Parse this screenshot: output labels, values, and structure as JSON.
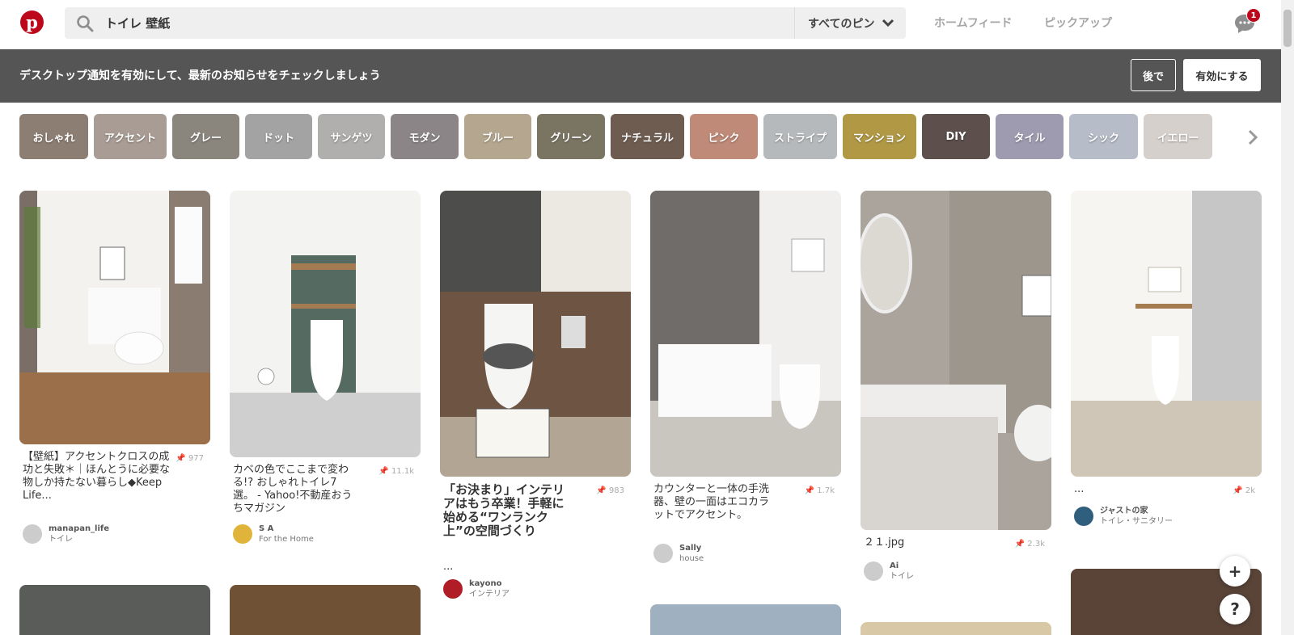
{
  "search": {
    "query": "トイレ 壁紙",
    "scope": "すべてのピン"
  },
  "nav": {
    "home_feed": "ホームフィード",
    "picks": "ピックアップ",
    "messages_badge": "1"
  },
  "notification": {
    "text": "デスクトップ通知を有効にして、最新のお知らせをチェックしましょう",
    "later": "後で",
    "enable": "有効にする"
  },
  "categories": [
    {
      "label": "おしゃれ",
      "color": "#8d7e73"
    },
    {
      "label": "アクセント",
      "color": "#a89c94"
    },
    {
      "label": "グレー",
      "color": "#8a857d"
    },
    {
      "label": "ドット",
      "color": "#a3a3a3"
    },
    {
      "label": "サンゲツ",
      "color": "#b0afad"
    },
    {
      "label": "モダン",
      "color": "#8b8587"
    },
    {
      "label": "ブルー",
      "color": "#b5a78f"
    },
    {
      "label": "グリーン",
      "color": "#7a7563"
    },
    {
      "label": "ナチュラル",
      "color": "#6e5c50"
    },
    {
      "label": "ピンク",
      "color": "#bf8a78"
    },
    {
      "label": "ストライプ",
      "color": "#b6b9bb"
    },
    {
      "label": "マンション",
      "color": "#b09845"
    },
    {
      "label": "DIY",
      "color": "#5c4f4c"
    },
    {
      "label": "タイル",
      "color": "#9e9bb0"
    },
    {
      "label": "シック",
      "color": "#b6bcc8"
    },
    {
      "label": "イエロー",
      "color": "#d6d0cd"
    }
  ],
  "pins": [
    {
      "title": "【壁紙】アクセントクロスの成功と失敗＊｜ほんとうに必要な物しか持たない暮らし◆Keep Life...",
      "saves": "977",
      "user": "manapan_life",
      "board": "トイレ"
    },
    {
      "title": "カベの色でここまで変わる!? おしゃれトイレ7選。 - Yahoo!不動産おうちマガジン",
      "saves": "11.1k",
      "user": "S A",
      "board": "For the Home"
    },
    {
      "title": "「お決まり」インテリアはもう卒業！手軽に始める“ワンランク上”の空間づくり",
      "extra": "...",
      "saves": "983",
      "user": "kayono",
      "board": "インテリア"
    },
    {
      "title": "カウンターと一体の手洗器、壁の一面はエコカラットでアクセント。",
      "saves": "1.7k",
      "user": "Sally",
      "board": "house"
    },
    {
      "title": "２１.jpg",
      "saves": "2.3k",
      "user": "Ai",
      "board": "トイレ"
    },
    {
      "title": "...",
      "saves": "2k",
      "user": "ジャストの家",
      "board": "トイレ・サニタリー"
    }
  ],
  "fab": {
    "add": "+",
    "help": "?"
  }
}
